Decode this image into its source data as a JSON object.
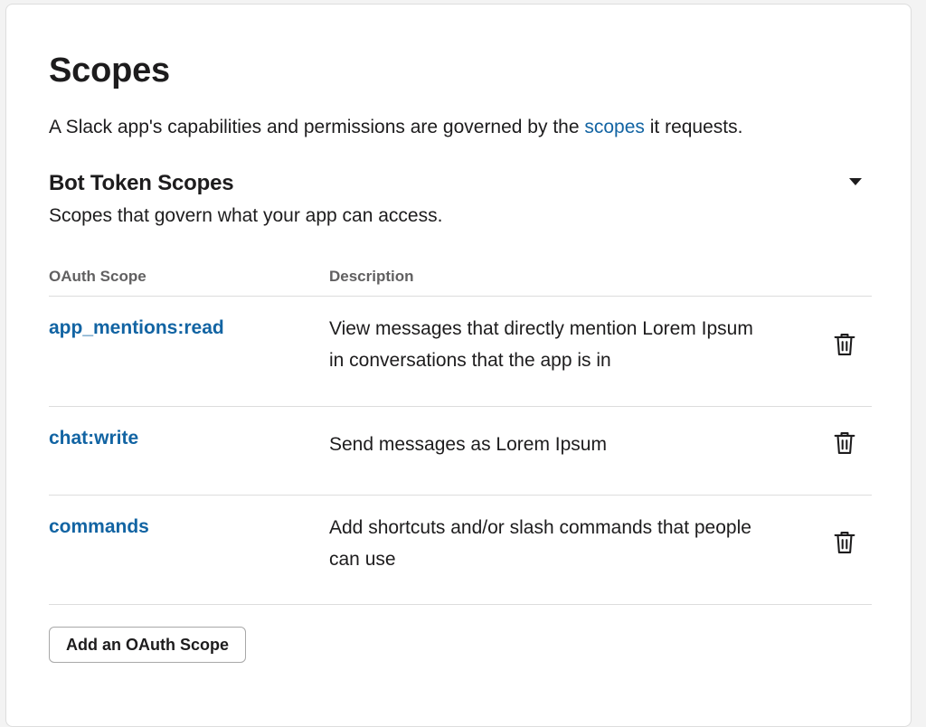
{
  "page": {
    "title": "Scopes",
    "intro_before": "A Slack app's capabilities and permissions are governed by the ",
    "intro_link": "scopes",
    "intro_after": " it requests."
  },
  "bot_section": {
    "title": "Bot Token Scopes",
    "subtitle": "Scopes that govern what your app can access.",
    "collapse_icon": "caret-down-icon",
    "columns": {
      "scope": "OAuth Scope",
      "description": "Description"
    },
    "rows": [
      {
        "scope": "app_mentions:read",
        "description": "View messages that directly mention Lorem Ipsum in conversations that the app is in",
        "action_icon": "trash-icon"
      },
      {
        "scope": "chat:write",
        "description": "Send messages as Lorem Ipsum",
        "action_icon": "trash-icon"
      },
      {
        "scope": "commands",
        "description": "Add shortcuts and/or slash commands that people can use",
        "action_icon": "trash-icon"
      }
    ],
    "add_button_label": "Add an OAuth Scope"
  },
  "colors": {
    "link": "#1264a3",
    "text": "#1d1c1d",
    "muted": "#616061",
    "divider": "#dddddd"
  }
}
